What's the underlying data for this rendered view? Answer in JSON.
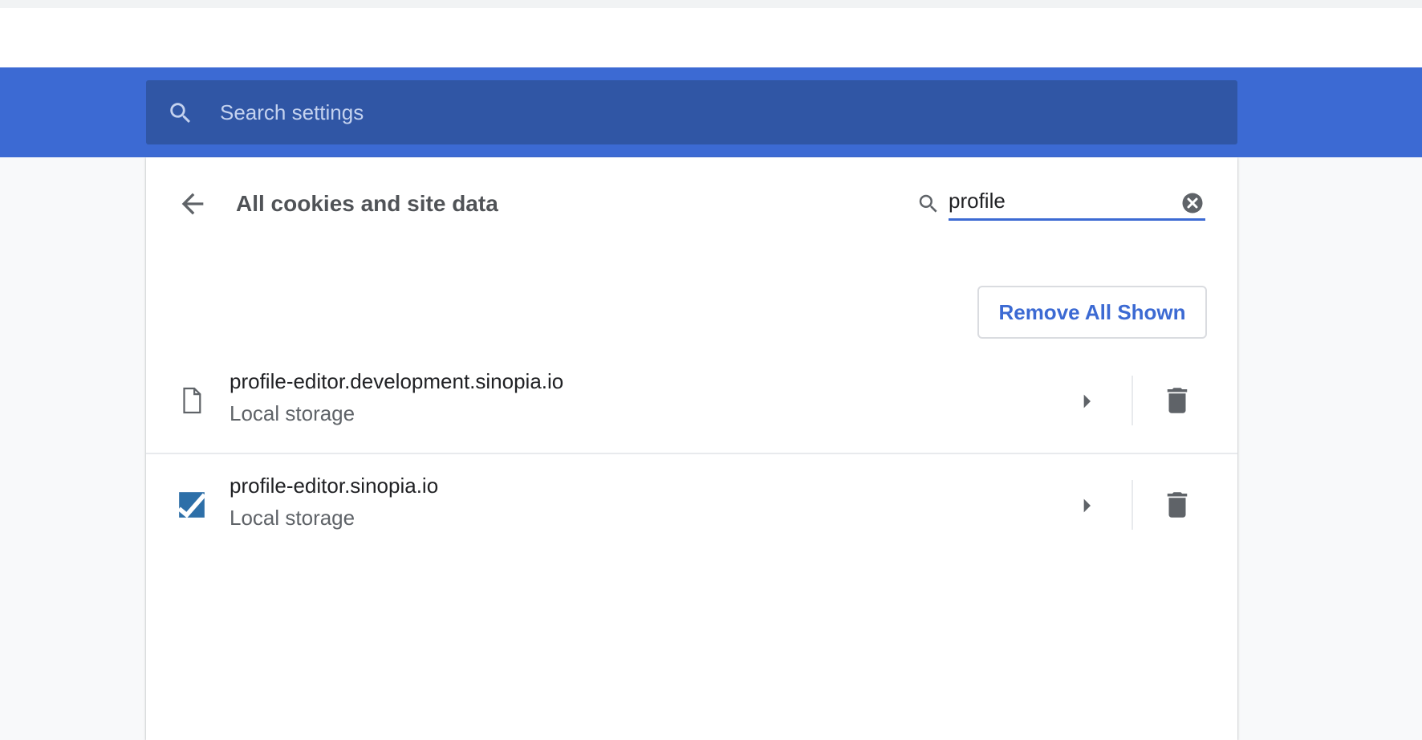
{
  "header": {
    "search_placeholder": "Search settings",
    "search_icon": "search-icon"
  },
  "page": {
    "title": "All cookies and site data",
    "back_icon": "arrow-back-icon",
    "filter": {
      "value": "profile",
      "icon": "search-icon",
      "clear_icon": "close-circle-icon"
    },
    "remove_all_label": "Remove All Shown"
  },
  "sites": [
    {
      "name": "profile-editor.development.sinopia.io",
      "detail": "Local storage",
      "icon": "file-icon"
    },
    {
      "name": "profile-editor.sinopia.io",
      "detail": "Local storage",
      "icon": "checkmark-favicon-icon"
    }
  ],
  "colors": {
    "accent": "#3c6ad3",
    "search_bar": "#3056a5",
    "icon_gray": "#5f6368"
  }
}
